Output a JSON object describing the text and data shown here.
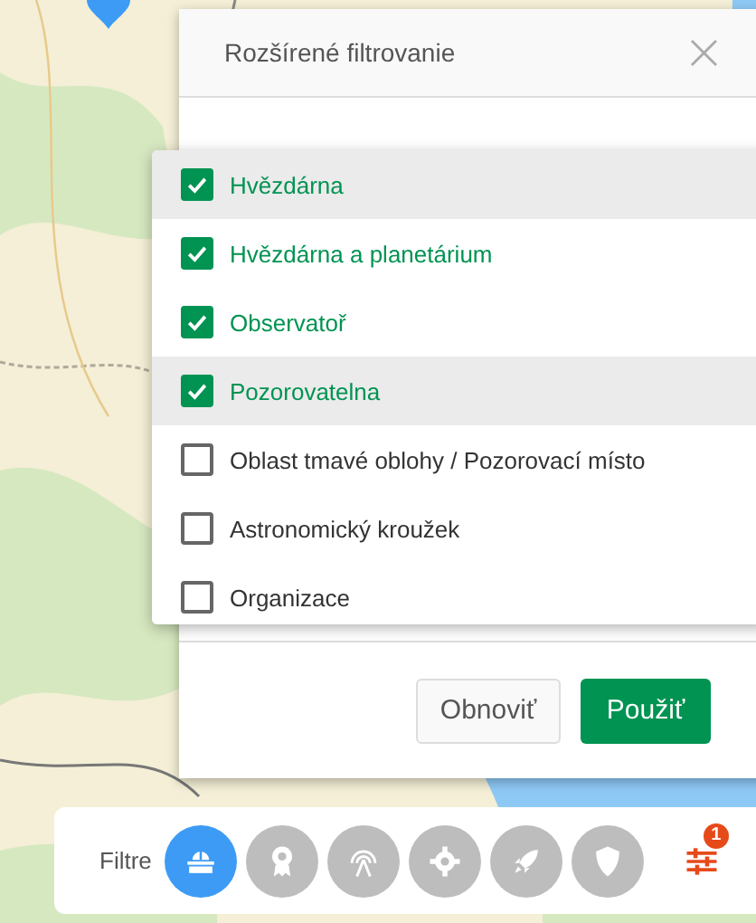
{
  "dialog": {
    "title": "Rozšírené filtrovanie",
    "close": "×"
  },
  "options": [
    {
      "label": "Hvězdárna",
      "checked": true,
      "highlighted": true
    },
    {
      "label": "Hvězdárna a planetárium",
      "checked": true,
      "highlighted": false
    },
    {
      "label": "Observatoř",
      "checked": true,
      "highlighted": false
    },
    {
      "label": "Pozorovatelna",
      "checked": true,
      "highlighted": true
    },
    {
      "label": "Oblast tmavé oblohy / Pozorovací místo",
      "checked": false,
      "highlighted": false
    },
    {
      "label": "Astronomický kroužek",
      "checked": false,
      "highlighted": false
    },
    {
      "label": "Organizace",
      "checked": false,
      "highlighted": false
    }
  ],
  "buttons": [
    {
      "label": "Obnoviť",
      "kind": "secondary"
    },
    {
      "label": "Použiť",
      "kind": "primary"
    }
  ],
  "filter_bar": {
    "label": "Filtre",
    "categories": [
      {
        "kind": "observatory",
        "selected": true
      },
      {
        "kind": "award",
        "selected": false
      },
      {
        "kind": "antenna",
        "selected": false
      },
      {
        "kind": "gear",
        "selected": false
      },
      {
        "kind": "rocket",
        "selected": false
      },
      {
        "kind": "shield",
        "selected": false
      }
    ],
    "badge": "1"
  }
}
